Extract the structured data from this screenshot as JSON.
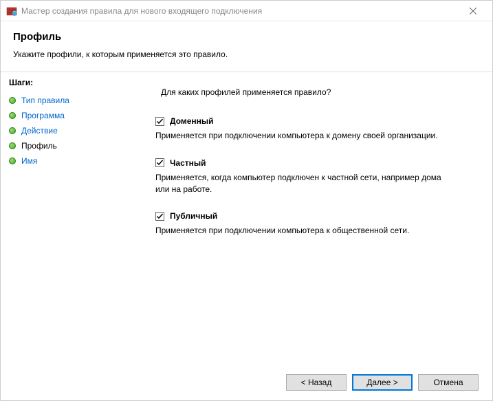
{
  "titlebar": {
    "text": "Мастер создания правила для нового входящего подключения"
  },
  "header": {
    "title": "Профиль",
    "subtitle": "Укажите профили, к которым применяется это правило."
  },
  "sidebar": {
    "heading": "Шаги:",
    "items": [
      {
        "label": "Тип правила"
      },
      {
        "label": "Программа"
      },
      {
        "label": "Действие"
      },
      {
        "label": "Профиль"
      },
      {
        "label": "Имя"
      }
    ]
  },
  "main": {
    "intro": "Для каких профилей применяется правило?",
    "profiles": [
      {
        "label": "Доменный",
        "desc": "Применяется при подключении компьютера к домену своей организации.",
        "checked": true
      },
      {
        "label": "Частный",
        "desc": "Применяется, когда компьютер подключен к частной сети, например дома или на работе.",
        "checked": true
      },
      {
        "label": "Публичный",
        "desc": "Применяется при подключении компьютера к общественной сети.",
        "checked": true
      }
    ]
  },
  "footer": {
    "back": "< Назад",
    "next": "Далее >",
    "cancel": "Отмена"
  }
}
